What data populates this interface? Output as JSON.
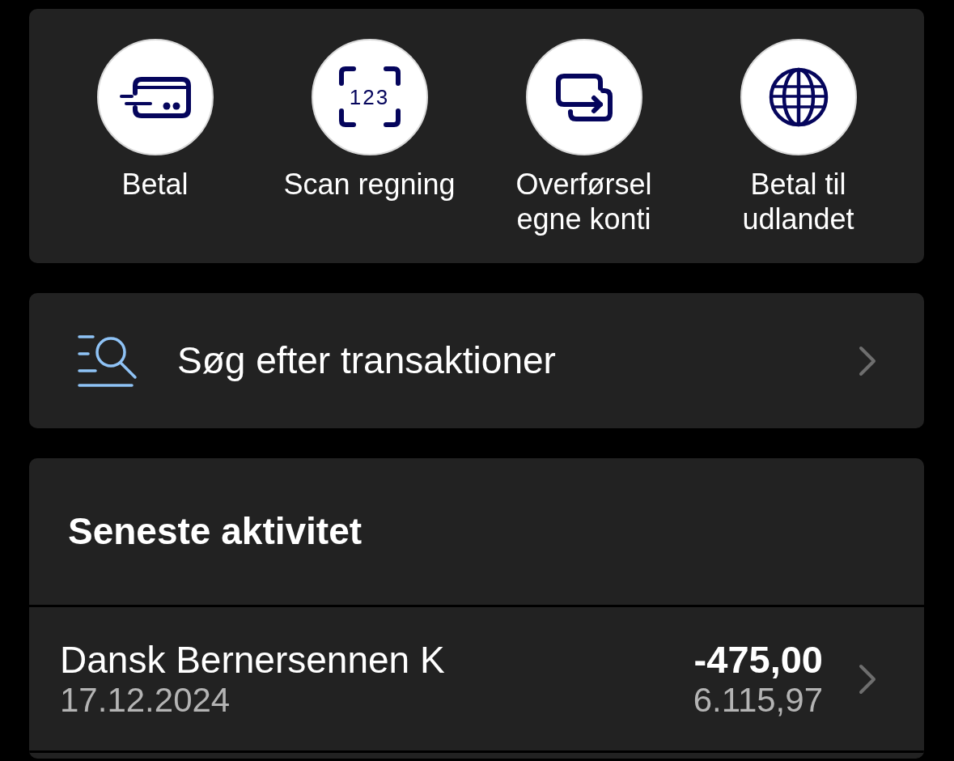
{
  "quick_actions": [
    {
      "kind": "card",
      "label": "Betal"
    },
    {
      "kind": "scan",
      "label": "Scan regning",
      "icon_text": "123"
    },
    {
      "kind": "transfer",
      "label": "Overførsel egne konti"
    },
    {
      "kind": "globe",
      "label": "Betal til udlandet"
    }
  ],
  "search": {
    "label": "Søg efter transaktioner"
  },
  "recent_activity": {
    "title": "Seneste aktivitet",
    "transactions": [
      {
        "name": "Dansk Bernersennen K",
        "date": "17.12.2024",
        "amount": "-475,00",
        "balance": "6.115,97"
      }
    ]
  }
}
